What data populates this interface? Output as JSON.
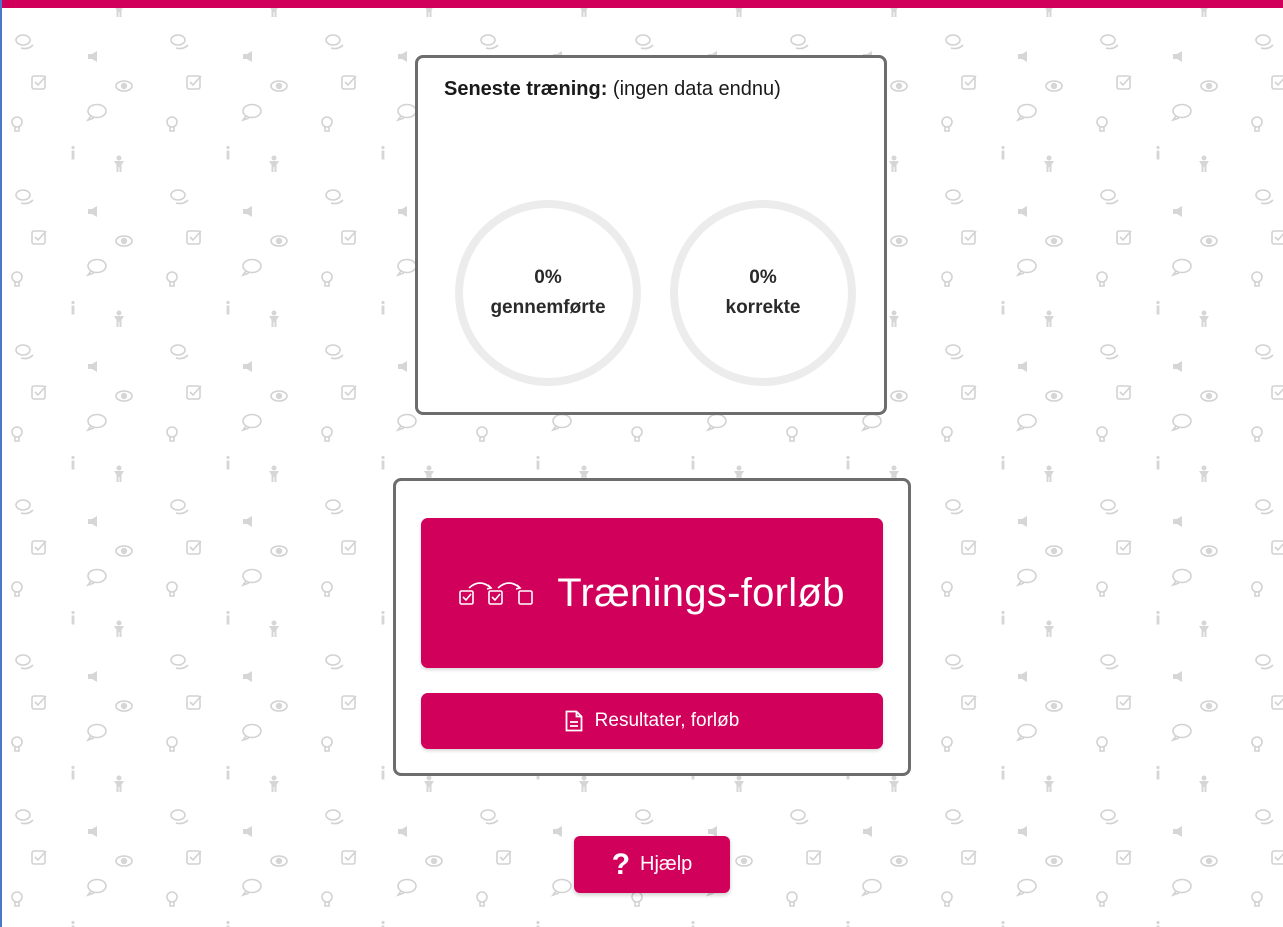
{
  "colors": {
    "accent": "#d1005a",
    "card_border": "#6d6d6d",
    "ring_track": "#ececec",
    "pattern_icon": "#d2d2d2",
    "window_edge": "#4a78c8"
  },
  "background": {
    "pattern_icons": [
      "speech-bubbles-icon",
      "speaker-icon",
      "person-icon",
      "checkbox-icon",
      "eye-icon",
      "lightbulb-icon",
      "info-icon",
      "speech-bubble-icon"
    ]
  },
  "stats": {
    "heading_label": "Seneste træning:",
    "heading_value": "(ingen data endnu)",
    "completed": {
      "value": "0%",
      "label": "gennemførte",
      "progress": 0
    },
    "correct": {
      "value": "0%",
      "label": "korrekte",
      "progress": 0
    }
  },
  "actions": {
    "course_icon": "checklist-progress-icon",
    "course_label": "Trænings-forløb",
    "results_icon": "document-icon",
    "results_label": "Resultater, forløb"
  },
  "help": {
    "icon": "question-mark-icon",
    "label": "Hjælp"
  }
}
